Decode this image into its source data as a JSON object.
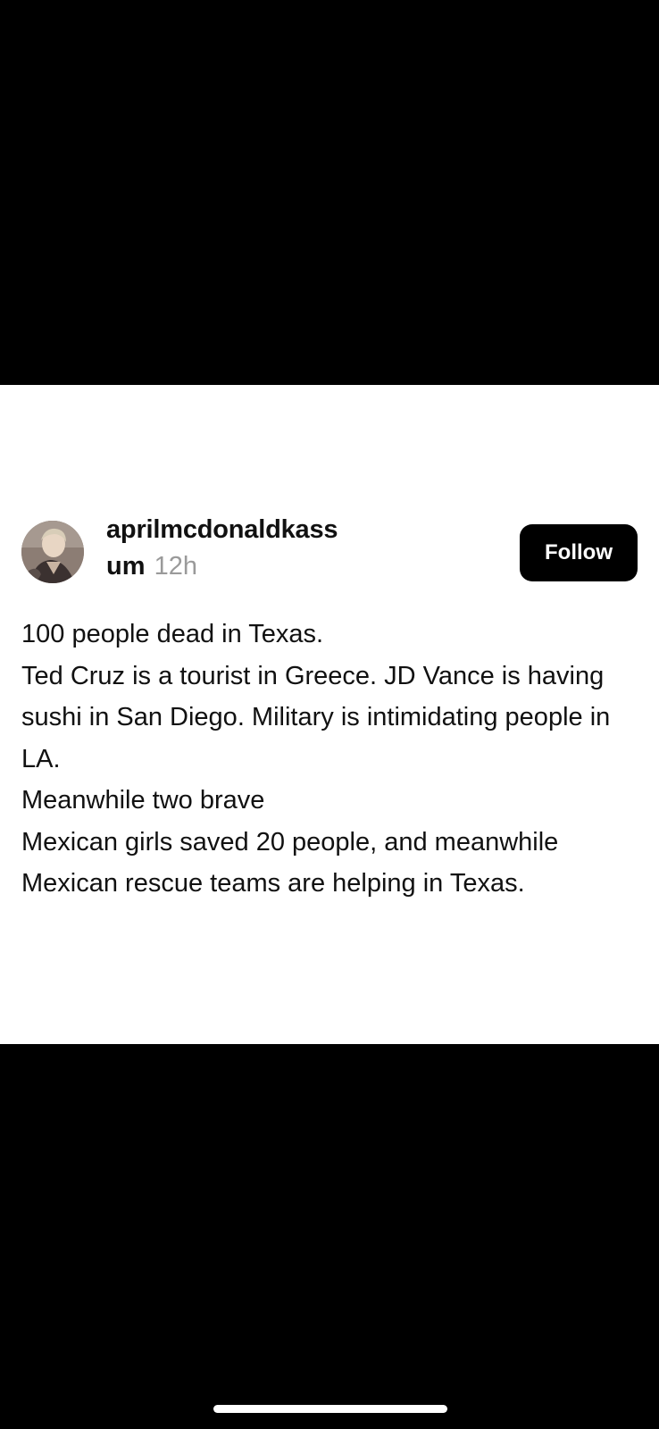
{
  "post": {
    "author": {
      "username_line1": "aprilmcdonaldkass",
      "username_line2": "um",
      "timestamp": "12h"
    },
    "follow_label": "Follow",
    "lines": [
      "100 people dead in Texas.",
      "Ted Cruz is a tourist in Greece. JD Vance is having sushi in San Diego. Military is intimidating people in LA.",
      "Meanwhile two brave",
      "Mexican girls saved 20 people, and meanwhile Mexican rescue teams are helping in Texas."
    ]
  },
  "colors": {
    "background": "#000000",
    "card": "#ffffff",
    "text": "#111111",
    "timestamp": "#9a9a9a",
    "button": "#000000",
    "button_text": "#ffffff"
  },
  "icons": {
    "avatar": "profile-photo"
  }
}
